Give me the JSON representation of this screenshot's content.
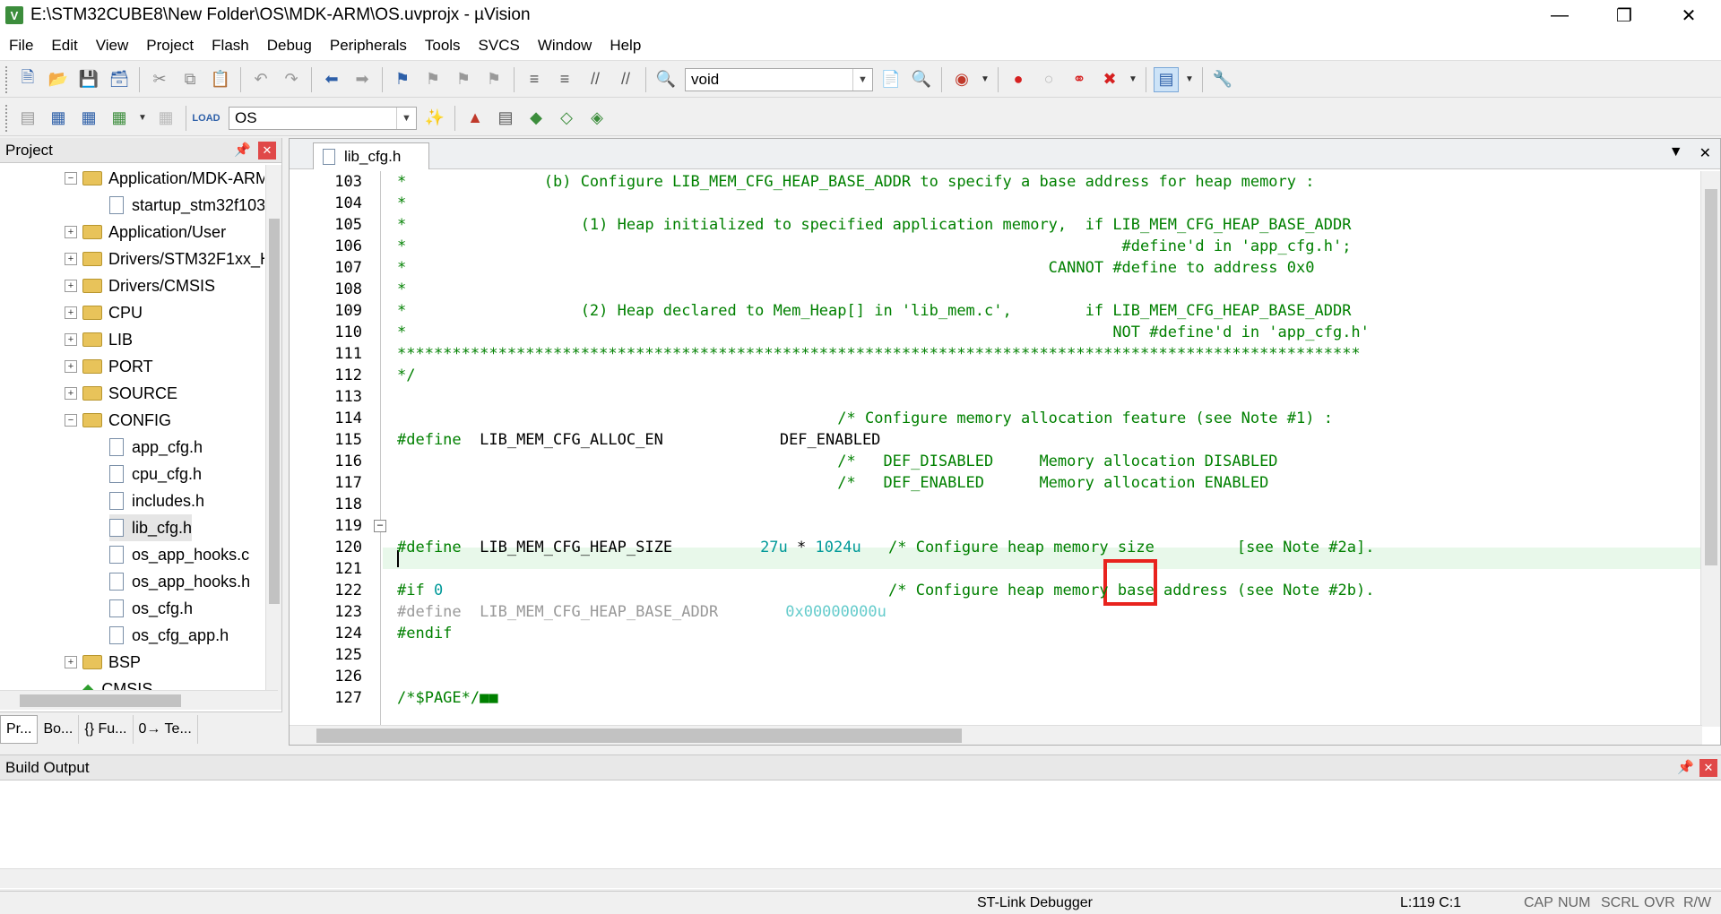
{
  "window": {
    "title": "E:\\STM32CUBE8\\New Folder\\OS\\MDK-ARM\\OS.uvprojx - µVision"
  },
  "menu": [
    "File",
    "Edit",
    "View",
    "Project",
    "Flash",
    "Debug",
    "Peripherals",
    "Tools",
    "SVCS",
    "Window",
    "Help"
  ],
  "toolbar": {
    "search_value": "void",
    "target_value": "OS"
  },
  "project_panel": {
    "title": "Project",
    "tree": [
      {
        "label": "Application/MDK-ARM",
        "type": "folder",
        "expanded": true,
        "level": 0
      },
      {
        "label": "startup_stm32f103xe.s",
        "type": "file",
        "level": 1
      },
      {
        "label": "Application/User",
        "type": "folder",
        "expanded": false,
        "level": 0
      },
      {
        "label": "Drivers/STM32F1xx_HAL_Driver",
        "type": "folder",
        "expanded": false,
        "level": 0
      },
      {
        "label": "Drivers/CMSIS",
        "type": "folder",
        "expanded": false,
        "level": 0
      },
      {
        "label": "CPU",
        "type": "folder",
        "expanded": false,
        "level": 0
      },
      {
        "label": "LIB",
        "type": "folder",
        "expanded": false,
        "level": 0
      },
      {
        "label": "PORT",
        "type": "folder",
        "expanded": false,
        "level": 0
      },
      {
        "label": "SOURCE",
        "type": "folder",
        "expanded": false,
        "level": 0
      },
      {
        "label": "CONFIG",
        "type": "folder",
        "expanded": true,
        "level": 0
      },
      {
        "label": "app_cfg.h",
        "type": "file",
        "level": 1
      },
      {
        "label": "cpu_cfg.h",
        "type": "file",
        "level": 1
      },
      {
        "label": "includes.h",
        "type": "file",
        "level": 1
      },
      {
        "label": "lib_cfg.h",
        "type": "file",
        "level": 1,
        "selected": true
      },
      {
        "label": "os_app_hooks.c",
        "type": "file",
        "level": 1
      },
      {
        "label": "os_app_hooks.h",
        "type": "file",
        "level": 1
      },
      {
        "label": "os_cfg.h",
        "type": "file",
        "level": 1
      },
      {
        "label": "os_cfg_app.h",
        "type": "file",
        "level": 1
      },
      {
        "label": "BSP",
        "type": "folder",
        "expanded": false,
        "level": 0
      },
      {
        "label": "CMSIS",
        "type": "component",
        "level": 0
      }
    ],
    "tabs": [
      "Pr...",
      "Bo...",
      "{} Fu...",
      "0→ Te..."
    ]
  },
  "editor": {
    "tab_label": "lib_cfg.h",
    "lines": [
      {
        "n": "103",
        "t": "*               (b) Configure LIB_MEM_CFG_HEAP_BASE_ADDR to specify a base address for heap memory :"
      },
      {
        "n": "104",
        "t": "*"
      },
      {
        "n": "105",
        "t": "*                   (1) Heap initialized to specified application memory,  if LIB_MEM_CFG_HEAP_BASE_ADDR"
      },
      {
        "n": "106",
        "t": "*                                                                              #define'd in 'app_cfg.h';"
      },
      {
        "n": "107",
        "t": "*                                                                      CANNOT #define to address 0x0"
      },
      {
        "n": "108",
        "t": "*"
      },
      {
        "n": "109",
        "t": "*                   (2) Heap declared to Mem_Heap[] in 'lib_mem.c',        if LIB_MEM_CFG_HEAP_BASE_ADDR"
      },
      {
        "n": "110",
        "t": "*                                                                             NOT #define'd in 'app_cfg.h'"
      },
      {
        "n": "111",
        "t": "*********************************************************************************************************"
      },
      {
        "n": "112",
        "t": "*/"
      },
      {
        "n": "113",
        "t": ""
      },
      {
        "n": "114",
        "t": "                                                /* Configure memory allocation feature (see Note #1) :"
      },
      {
        "n": "115",
        "t": "",
        "kw": "#define",
        "name": "  LIB_MEM_CFG_ALLOC_EN",
        "val": "DEF_ENABLED"
      },
      {
        "n": "116",
        "t": "                                                /*   DEF_DISABLED     Memory allocation DISABLED"
      },
      {
        "n": "117",
        "t": "                                                /*   DEF_ENABLED      Memory allocation ENABLED"
      },
      {
        "n": "118",
        "t": ""
      },
      {
        "n": "119",
        "t": ""
      },
      {
        "n": "120",
        "t": "",
        "kw": "#define",
        "name": "  LIB_MEM_CFG_HEAP_SIZE",
        "num": "27u",
        "mul": " *",
        "num2": " 1024u",
        "cmt": "/* Configure heap memory size         [see Note #2a]."
      },
      {
        "n": "121",
        "t": ""
      },
      {
        "n": "122",
        "t": "",
        "kw": "#if",
        "num": " 0",
        "cmt": "/* Configure heap memory base address (see Note #2b)."
      },
      {
        "n": "123",
        "t": "",
        "kw": "#define",
        "name": "  LIB_MEM_CFG_HEAP_BASE_ADDR",
        "num": "0x00000000u",
        "inactive": true
      },
      {
        "n": "124",
        "t": "",
        "kw": "#endif"
      },
      {
        "n": "125",
        "t": ""
      },
      {
        "n": "126",
        "t": ""
      },
      {
        "n": "127",
        "t": "/*$PAGE*/■■"
      }
    ]
  },
  "build_output": {
    "title": "Build Output"
  },
  "statusbar": {
    "debugger": "ST-Link Debugger",
    "position": "L:119 C:1",
    "caps": "CAP",
    "num": "NUM",
    "scrl": "SCRL",
    "ovr": "OVR",
    "rw": "R/W"
  }
}
